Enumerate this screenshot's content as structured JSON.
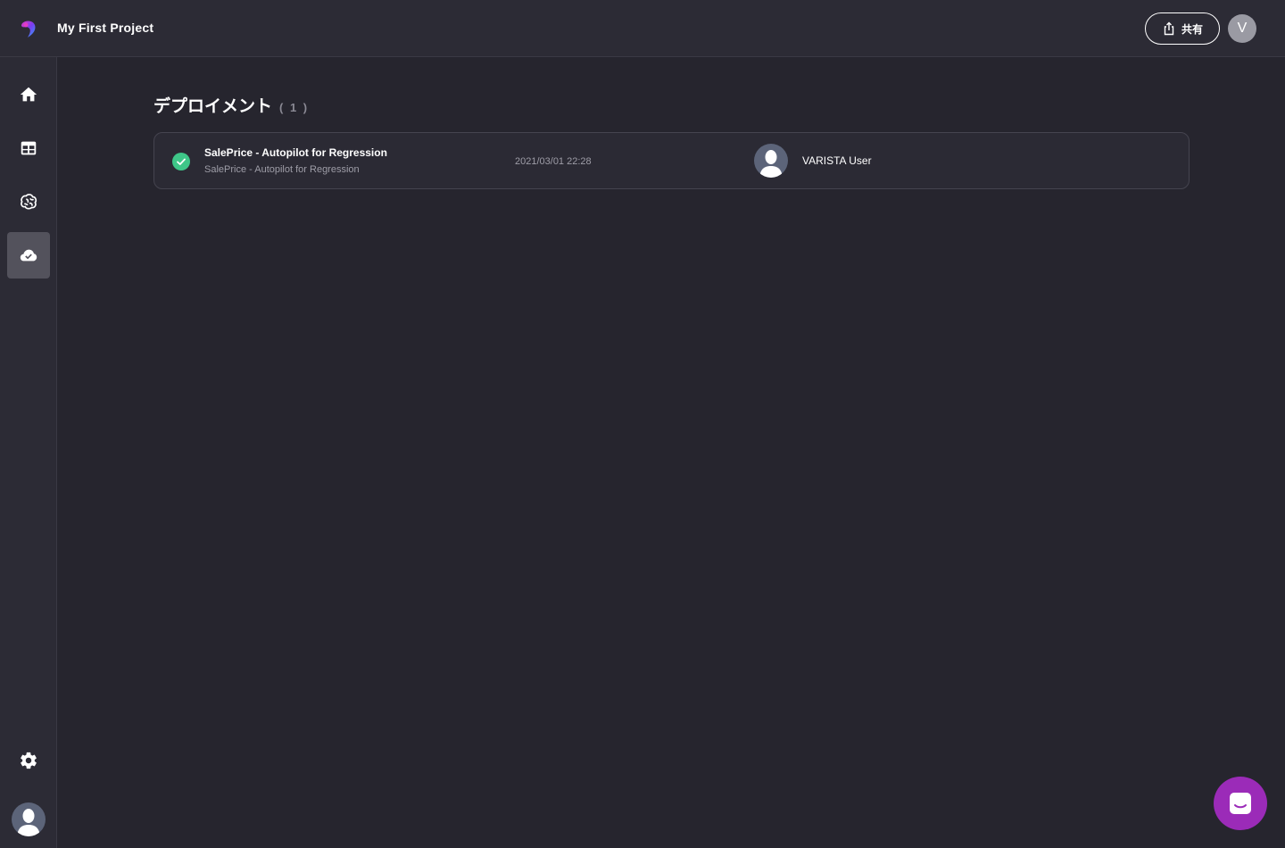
{
  "header": {
    "project_title": "My First Project",
    "share_label": "共有",
    "user_initial": "V"
  },
  "sidebar": {
    "items": [
      {
        "name": "home",
        "icon": "home-icon"
      },
      {
        "name": "datasets",
        "icon": "table-icon"
      },
      {
        "name": "models",
        "icon": "brain-icon"
      },
      {
        "name": "deployments",
        "icon": "cloud-check-icon",
        "active": true
      }
    ],
    "settings_icon": "gear-icon",
    "avatar_icon": "user-avatar-icon"
  },
  "main": {
    "heading": "デプロイメント",
    "count": "( 1 )",
    "deployments": [
      {
        "title": "SalePrice - Autopilot for Regression",
        "subtitle": "SalePrice - Autopilot for Regression",
        "date": "2021/03/01 22:28",
        "user": "VARISTA User",
        "status": "success"
      }
    ]
  },
  "chat": {
    "icon": "chat-icon"
  },
  "colors": {
    "background": "#26252e",
    "panel": "#2c2b35",
    "success": "#3ec688",
    "chat_accent": "#9b2bb8",
    "active_nav": "#53525c"
  }
}
